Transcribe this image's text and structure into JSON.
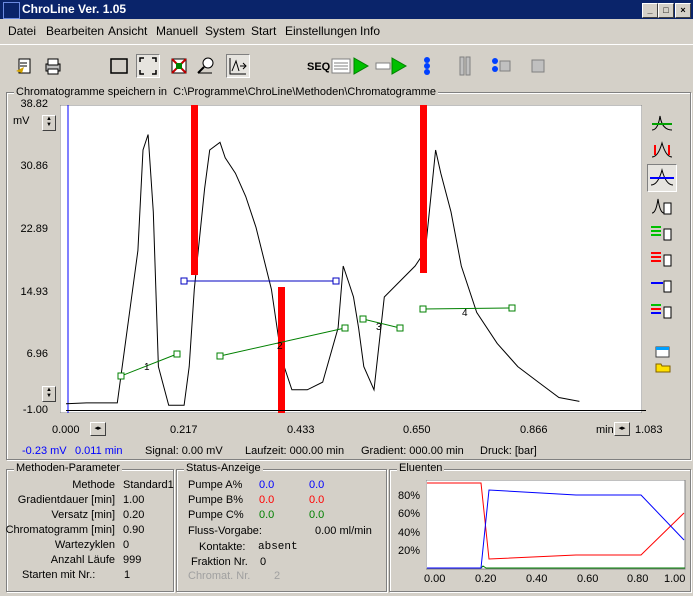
{
  "window": {
    "title": "ChroLine Ver. 1.05",
    "min_label": "_",
    "max_label": "□",
    "close_label": "×"
  },
  "menu": [
    "Datei",
    "Bearbeiten",
    "Ansicht",
    "Manuell",
    "System",
    "Start",
    "Einstellungen",
    "Info"
  ],
  "toolbar": {
    "seq_label": "SEQ"
  },
  "chrom": {
    "path_label": "Chromatogramme speichern in",
    "path_value": "C:\\Programme\\ChroLine\\Methoden\\Chromatogramme",
    "y_unit": "mV",
    "x_unit": "min",
    "status": {
      "cursor_mv": "-0.23 mV",
      "cursor_min": "0.011 min",
      "signal": "Signal:  0.00 mV",
      "laufzeit": "Laufzeit: 000.00 min",
      "gradient": "Gradient: 000.00 min",
      "druck": "Druck: [bar]"
    }
  },
  "chart_data": {
    "type": "line",
    "xlabel": "min",
    "ylabel": "mV",
    "xlim": [
      0.0,
      1.083
    ],
    "ylim": [
      -1.0,
      38.82
    ],
    "xticks": [
      "0.000",
      "0.217",
      "0.433",
      "0.650",
      "0.866",
      "1.083"
    ],
    "yticks": [
      "38.82",
      "30.86",
      "22.89",
      "14.93",
      "6.96",
      "-1.00"
    ],
    "series": [
      {
        "x": [
          0,
          0.04,
          0.08,
          0.1,
          0.14,
          0.15,
          0.16,
          0.17,
          0.18,
          0.2,
          0.22,
          0.23,
          0.24,
          0.25,
          0.27,
          0.28,
          0.3,
          0.31,
          0.33,
          0.35,
          0.37,
          0.4,
          0.42,
          0.44,
          0.47,
          0.5,
          0.53,
          0.54,
          0.55,
          0.56,
          0.57,
          0.58,
          0.6,
          0.62,
          0.65,
          0.68,
          0.7,
          0.72,
          0.73,
          0.75,
          0.77,
          0.8,
          0.84,
          0.88,
          0.92,
          0.96,
          1.0
        ],
        "y": [
          0.2,
          0.3,
          0.3,
          0.3,
          20,
          33,
          35,
          25,
          5,
          0,
          0,
          0,
          5,
          15,
          28,
          33,
          34,
          32,
          30,
          27,
          23,
          15,
          6,
          2,
          2,
          3,
          10,
          18,
          16,
          14,
          10,
          5,
          2,
          14,
          16,
          18,
          20,
          33,
          30,
          25,
          18,
          12,
          8,
          5,
          3,
          1,
          0.5
        ]
      }
    ],
    "peak_labels": [
      "1",
      "2",
      "3",
      "4"
    ]
  },
  "methoden": {
    "title": "Methoden-Parameter",
    "rows": [
      {
        "label": "Methode",
        "value": "Standard1"
      },
      {
        "label": "Gradientdauer [min]",
        "value": "1.00"
      },
      {
        "label": "Versatz [min]",
        "value": "0.20"
      },
      {
        "label": "Chromatogramm [min]",
        "value": "0.90"
      },
      {
        "label": "Wartezyklen",
        "value": "0"
      },
      {
        "label": "Anzahl Läufe",
        "value": "999"
      },
      {
        "label": "Starten mit Nr.:",
        "value": "1"
      }
    ]
  },
  "status": {
    "title": "Status-Anzeige",
    "pumps": [
      {
        "label": "Pumpe A%",
        "v1": "0.0",
        "v2": "0.0",
        "color": "#0000ff"
      },
      {
        "label": "Pumpe B%",
        "v1": "0.0",
        "v2": "0.0",
        "color": "#ff0000"
      },
      {
        "label": "Pumpe C%",
        "v1": "0.0",
        "v2": "0.0",
        "color": "#008000"
      }
    ],
    "fluss_label": "Fluss-Vorgabe:",
    "fluss_value": "0.00 ml/min",
    "kontakte_label": "Kontakte:",
    "kontakte_value": "absent",
    "fraktion_label": "Fraktion Nr.",
    "fraktion_value": "0",
    "chromat_label": "Chromat. Nr.",
    "chromat_value": "2"
  },
  "eluenten": {
    "title": "Eluenten",
    "yticks": [
      "80%",
      "60%",
      "40%",
      "20%"
    ],
    "xticks": [
      "0.00",
      "0.20",
      "0.40",
      "0.60",
      "0.80",
      "1.00"
    ]
  }
}
